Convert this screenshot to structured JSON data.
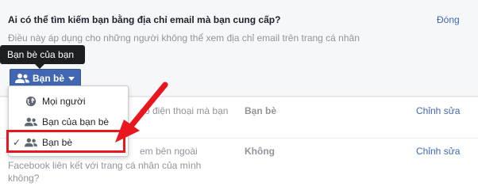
{
  "question": "Ai có thể tìm kiếm bạn bằng địa chỉ email mà bạn cung cấp?",
  "close_label": "Đóng",
  "note": "Điều này áp dụng cho những người không thể xem địa chỉ email trên trang cá nhân",
  "tooltip": "Bạn bè của bạn",
  "audience_button": {
    "label": "Bạn bè",
    "icon": "friends-icon"
  },
  "menu": {
    "items": [
      {
        "label": "Mọi người",
        "icon": "globe-icon",
        "selected": false
      },
      {
        "label": "Bạn của bạn bè",
        "icon": "friends-icon",
        "selected": false
      },
      {
        "label": "Bạn bè",
        "icon": "friends-icon",
        "selected": true
      }
    ]
  },
  "rows": [
    {
      "text_fragment": "số điện thoại mà bạn",
      "value": "Bạn bè",
      "edit": "Chỉnh sửa"
    },
    {
      "text_fragment": "em bên ngoài",
      "text_line2": "Facebook liên kết với trang cá nhân của mình",
      "text_line3": "không?",
      "value": "Không",
      "edit": "Chỉnh sửa"
    }
  ],
  "colors": {
    "accent": "#4267b2",
    "highlight": "#e8161f",
    "tooltip_bg": "#1c1e21"
  }
}
